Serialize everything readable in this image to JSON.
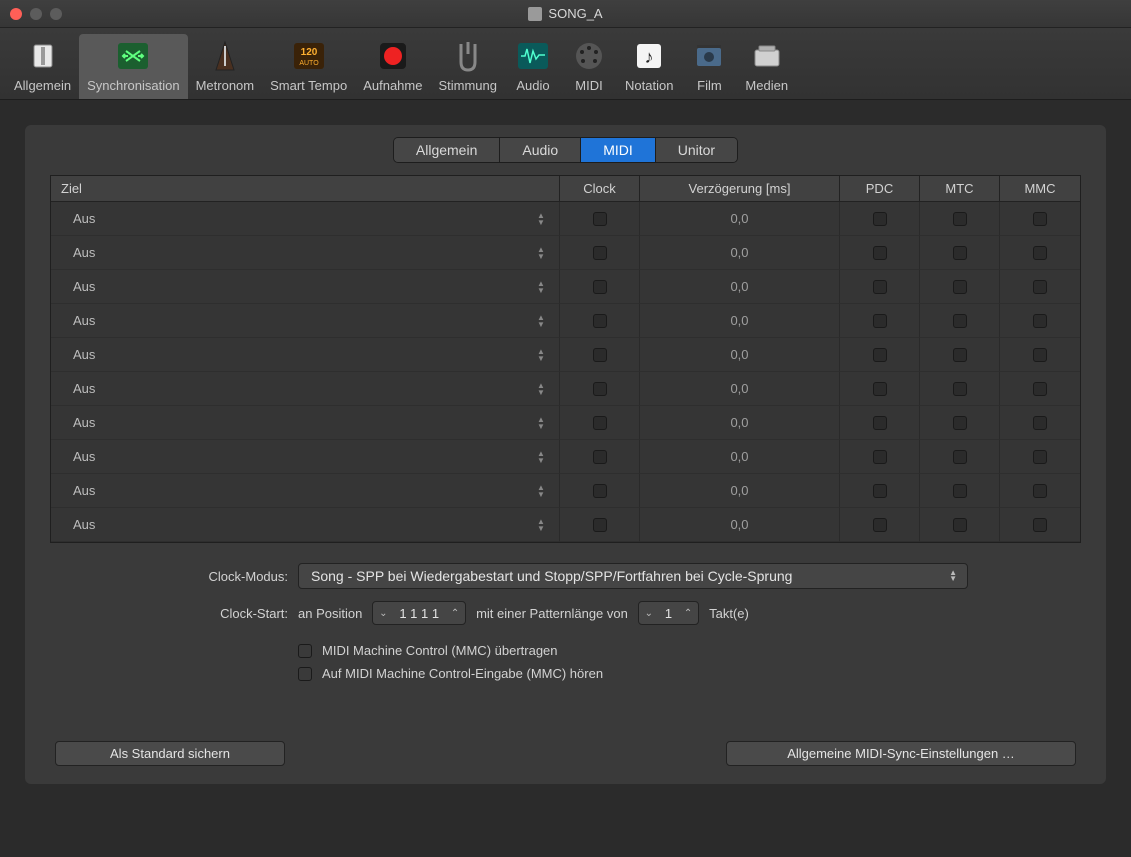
{
  "title": "SONG_A",
  "toolbar": [
    {
      "id": "allgemein",
      "label": "Allgemein"
    },
    {
      "id": "synchronisation",
      "label": "Synchronisation",
      "selected": true
    },
    {
      "id": "metronom",
      "label": "Metronom"
    },
    {
      "id": "smarttempo",
      "label": "Smart Tempo"
    },
    {
      "id": "aufnahme",
      "label": "Aufnahme"
    },
    {
      "id": "stimmung",
      "label": "Stimmung"
    },
    {
      "id": "audio",
      "label": "Audio"
    },
    {
      "id": "midi",
      "label": "MIDI"
    },
    {
      "id": "notation",
      "label": "Notation"
    },
    {
      "id": "film",
      "label": "Film"
    },
    {
      "id": "medien",
      "label": "Medien"
    }
  ],
  "subtabs": {
    "allgemein": "Allgemein",
    "audio": "Audio",
    "midi": "MIDI",
    "unitor": "Unitor",
    "active": "midi"
  },
  "table": {
    "headers": {
      "ziel": "Ziel",
      "clock": "Clock",
      "delay": "Verzögerung [ms]",
      "pdc": "PDC",
      "mtc": "MTC",
      "mmc": "MMC"
    },
    "rows": [
      {
        "ziel": "Aus",
        "delay": "0,0"
      },
      {
        "ziel": "Aus",
        "delay": "0,0"
      },
      {
        "ziel": "Aus",
        "delay": "0,0"
      },
      {
        "ziel": "Aus",
        "delay": "0,0"
      },
      {
        "ziel": "Aus",
        "delay": "0,0"
      },
      {
        "ziel": "Aus",
        "delay": "0,0"
      },
      {
        "ziel": "Aus",
        "delay": "0,0"
      },
      {
        "ziel": "Aus",
        "delay": "0,0"
      },
      {
        "ziel": "Aus",
        "delay": "0,0"
      },
      {
        "ziel": "Aus",
        "delay": "0,0"
      }
    ]
  },
  "form": {
    "clockModusLabel": "Clock-Modus:",
    "clockModusValue": "Song - SPP bei Wiedergabestart und Stopp/SPP/Fortfahren bei Cycle-Sprung",
    "clockStartLabel": "Clock-Start:",
    "clockStartText": "an Position",
    "positionValue": "1 1 1     1",
    "patternText": "mit einer Patternlänge von",
    "patternValue": "1",
    "taktLabel": "Takt(e)",
    "mmcTransmit": "MIDI Machine Control (MMC) übertragen",
    "mmcListen": "Auf MIDI Machine Control-Eingabe (MMC) hören"
  },
  "buttons": {
    "saveDefault": "Als Standard sichern",
    "generalMidi": "Allgemeine MIDI-Sync-Einstellungen …"
  }
}
